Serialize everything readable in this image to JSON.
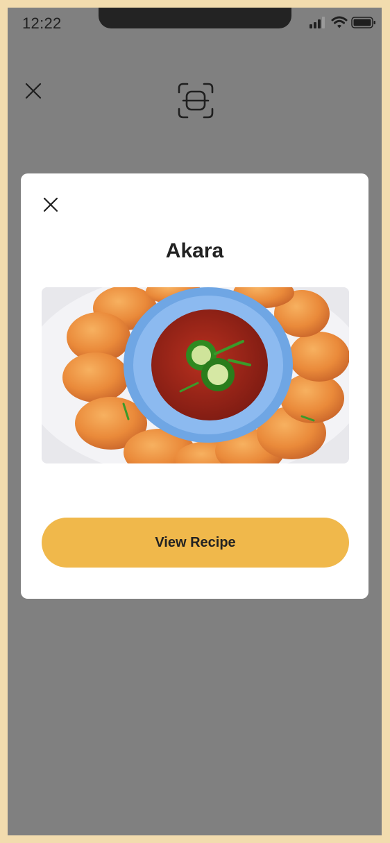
{
  "status_bar": {
    "time": "12:22",
    "icons": [
      "signal-icon",
      "wifi-icon",
      "battery-icon"
    ]
  },
  "background": {
    "close_icon": "close-icon",
    "scan_icon": "scan-frame-icon",
    "overlay_color": "#808080"
  },
  "modal": {
    "close_icon": "close-icon",
    "title": "Akara",
    "image_subject": "food-photo-akara",
    "button_label": "View Recipe",
    "button_color": "#f0b84b"
  },
  "frame_color": "#f2dcae"
}
